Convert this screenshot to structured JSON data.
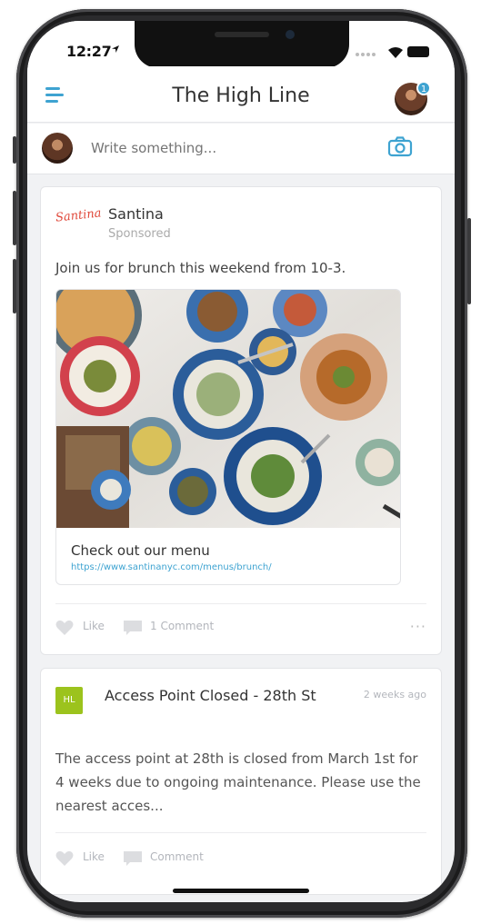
{
  "status_bar": {
    "time": "12:27"
  },
  "header": {
    "title": "The High Line",
    "notification_count": "1"
  },
  "composer": {
    "placeholder": "Write something..."
  },
  "post1": {
    "brand_logo_text": "Santina",
    "author": "Santina",
    "label": "Sponsored",
    "text": "Join us for brunch this weekend from 10-3.",
    "link": {
      "title": "Check out our menu",
      "url": "https://www.santinanyc.com/menus/brunch/"
    },
    "like_label": "Like",
    "comment_label": "1 Comment"
  },
  "post2": {
    "icon_text": "HL",
    "title": "Access Point Closed - 28th St",
    "time": "2 weeks ago",
    "body": "The access point at 28th is closed from March 1st for 4 weeks due to ongoing maintenance. Please use the nearest acces...",
    "like_label": "Like",
    "comment_label": "Comment"
  },
  "colors": {
    "accent": "#3ea3d1",
    "brand_red": "#e0483a",
    "notice_green": "#9cc31d"
  },
  "icons": [
    "menu-icon",
    "camera-icon",
    "heart-icon",
    "comment-icon",
    "more-icon"
  ]
}
